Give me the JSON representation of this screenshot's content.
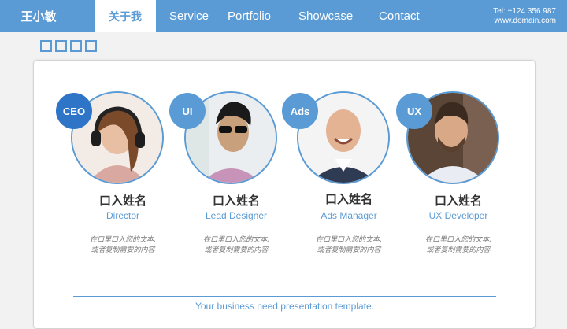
{
  "header": {
    "brand": "王小敏",
    "nav": [
      {
        "label": "关于我",
        "active": true
      },
      {
        "label": "Service",
        "active": false
      },
      {
        "label": "Portfolio",
        "active": false
      },
      {
        "label": "Showcase",
        "active": false
      },
      {
        "label": "Contact",
        "active": false
      }
    ],
    "phone": "Tel: +124 356 987",
    "website": "www.domain.com"
  },
  "team": [
    {
      "badge": "CEO",
      "name": "口入姓名",
      "role": "Director",
      "desc_line1": "在口里口入您的文本,",
      "desc_line2": "或者复制需要的内容"
    },
    {
      "badge": "UI",
      "name": "口入姓名",
      "role": "Lead Designer",
      "desc_line1": "在口里口入您的文本,",
      "desc_line2": "或者复制需要的内容"
    },
    {
      "badge": "Ads",
      "name": "口入姓名",
      "role": "Ads Manager",
      "desc_line1": "在口里口入您的文本,",
      "desc_line2": "或者复制需要的内容"
    },
    {
      "badge": "UX",
      "name": "口入姓名",
      "role": "UX Developer",
      "desc_line1": "在口里口入您的文本,",
      "desc_line2": "或者复制需要的内容"
    }
  ],
  "footer": {
    "tagline": "Your business need presentation template."
  },
  "colors": {
    "accent": "#5b9bd5",
    "accent_dark": "#2e75c7",
    "background": "#f2f2f2"
  }
}
